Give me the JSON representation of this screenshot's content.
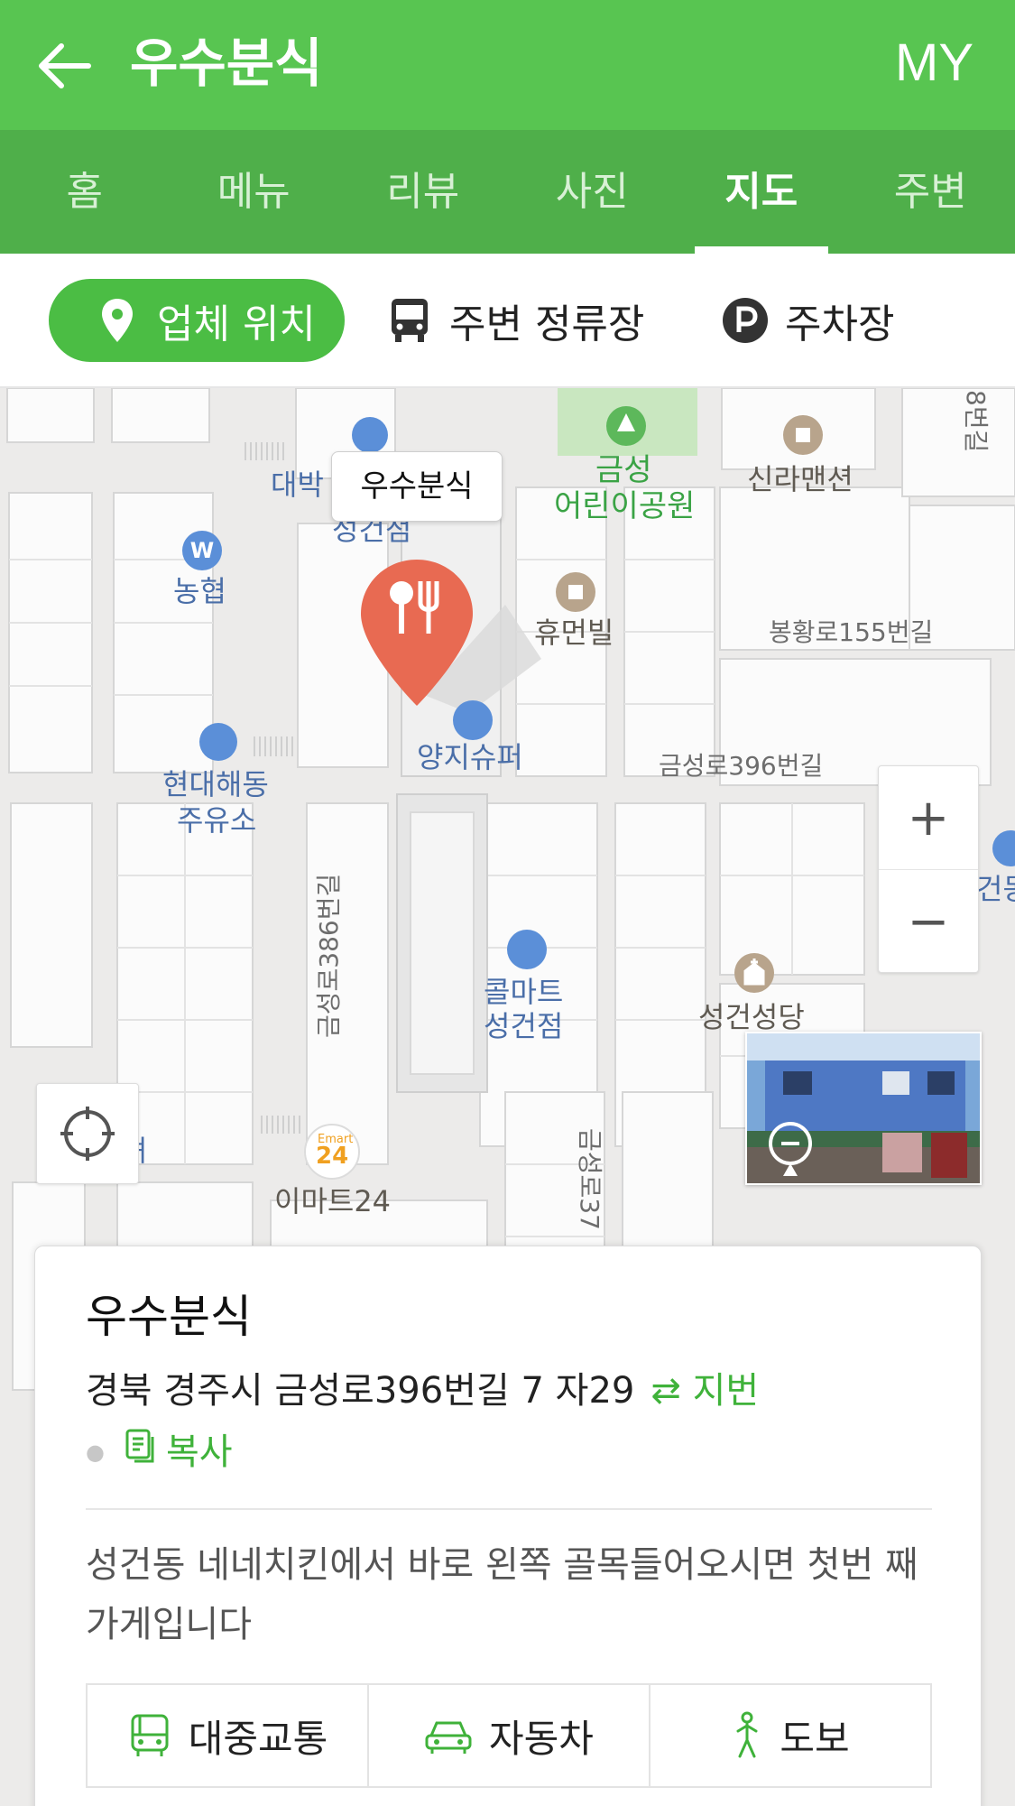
{
  "header": {
    "title": "우수분식",
    "my_label": "MY",
    "back_icon": "arrow-left-icon"
  },
  "tabs": [
    {
      "label": "홈",
      "active": false
    },
    {
      "label": "메뉴",
      "active": false
    },
    {
      "label": "리뷰",
      "active": false
    },
    {
      "label": "사진",
      "active": false
    },
    {
      "label": "지도",
      "active": true
    },
    {
      "label": "주변",
      "active": false
    }
  ],
  "filters": [
    {
      "label": "업체 위치",
      "icon": "location-pin-icon",
      "active": true
    },
    {
      "label": "주변 정류장",
      "icon": "bus-icon",
      "active": false
    },
    {
      "label": "주차장",
      "icon": "parking-icon",
      "active": false
    }
  ],
  "map": {
    "marker_label": "우수분식",
    "pois": {
      "daebak": "대박",
      "seonggeon": "성건점",
      "nonghyup": "농협",
      "park_1": "금성",
      "park_2": "어린이공원",
      "silla": "신라맨션",
      "human": "휴먼빌",
      "yangji": "양지슈퍼",
      "hyundai_1": "현대해동",
      "hyundai_2": "주유소",
      "colmart_1": "콜마트",
      "colmart_2": "성건점",
      "church": "성건성당",
      "emart_logo_1": "Emart",
      "emart_logo_2": "24",
      "emart": "이마트24",
      "partial_right": "건동",
      "partial_left": "녀"
    },
    "roads": {
      "r1": "봉황로155번길",
      "r2": "금성로396번길",
      "r3": "금성로386번길",
      "r4": "금성로37",
      "r5": "8번길"
    },
    "zoom_in": "+",
    "zoom_out": "−",
    "colors": {
      "marker": "#e86a52",
      "park": "#c9e7c0",
      "block": "#fbfbfb",
      "road": "#e8e8e8"
    }
  },
  "card": {
    "name": "우수분식",
    "address": "경북 경주시 금성로396번길 7 자29",
    "jibun_label": "지번",
    "copy_label": "복사",
    "description": "성건동 네네치킨에서 바로 왼쪽 골목들어오시면 첫번 째가게입니다",
    "buttons": [
      {
        "label": "대중교통",
        "icon": "bus-outline-icon"
      },
      {
        "label": "자동차",
        "icon": "car-icon"
      },
      {
        "label": "도보",
        "icon": "walking-icon"
      }
    ]
  },
  "colors": {
    "brand_green": "#58c551",
    "tab_green": "#4faf4a",
    "accent_green": "#3fb23a"
  }
}
